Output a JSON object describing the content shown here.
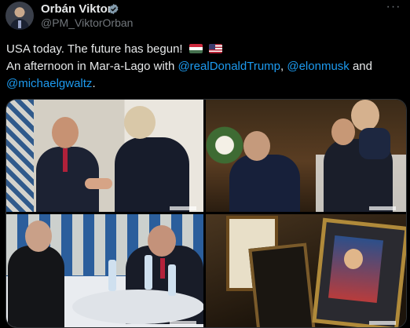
{
  "author": {
    "name": "Orbán Viktor",
    "handle": "@PM_ViktorOrban",
    "verified_icon": "verified-badge-icon"
  },
  "post": {
    "line1": "USA today. The future has begun!",
    "line1_flags": [
      "hungary-flag",
      "usa-flag"
    ],
    "line2_prefix": "An afternoon in Mar-a-Lago with ",
    "mention1": "@realDonaldTrump",
    "sep1": ", ",
    "mention2": "@elonmusk",
    "line2_suffix": " and",
    "mention3": "@michaelgwaltz",
    "line3_suffix": "."
  },
  "media": {
    "count": 4,
    "photos": [
      "photo-handshake",
      "photo-greeting-family",
      "photo-meeting-table",
      "photo-framed-portraits"
    ]
  },
  "colors": {
    "background": "#000000",
    "text": "#e7e9ea",
    "secondary": "#71767b",
    "link": "#1d9bf0",
    "verified": "#829aab"
  }
}
